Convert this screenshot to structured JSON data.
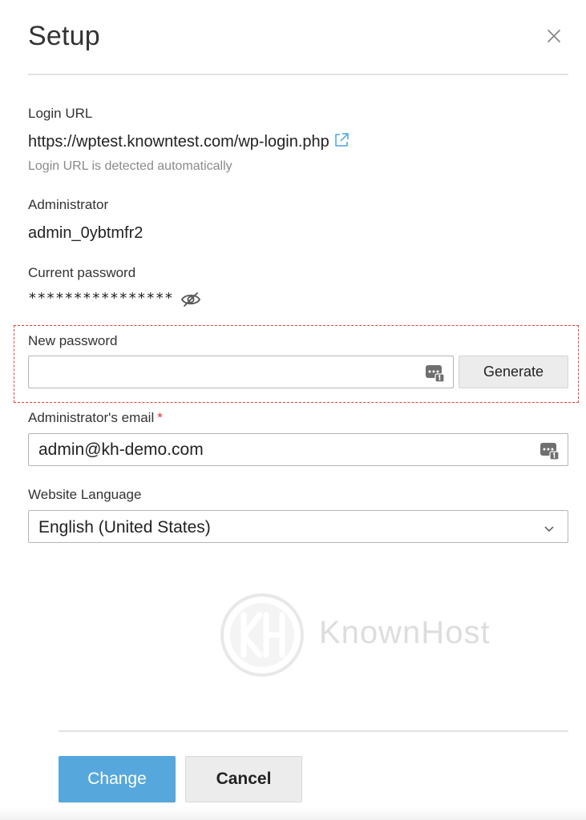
{
  "dialog": {
    "title": "Setup",
    "close_icon": "close-icon"
  },
  "login_url": {
    "label": "Login URL",
    "value": "https://wptest.knowntest.com/wp-login.php",
    "link_icon": "external-link-icon",
    "hint": "Login URL is detected automatically"
  },
  "administrator": {
    "label": "Administrator",
    "value": "admin_0ybtmfr2"
  },
  "current_password": {
    "label": "Current password",
    "masked_value": "****************",
    "toggle_icon": "eye-slash-icon"
  },
  "new_password": {
    "label": "New password",
    "value": "",
    "placeholder": "",
    "field_icon": "password-manager-icon",
    "generate_label": "Generate"
  },
  "admin_email": {
    "label": "Administrator's email",
    "required_mark": "*",
    "value": "admin@kh-demo.com",
    "field_icon": "password-manager-icon"
  },
  "language": {
    "label": "Website Language",
    "selected": "English (United States)",
    "chevron_icon": "chevron-down-icon"
  },
  "watermark": {
    "text": "KnownHost"
  },
  "footer": {
    "change_label": "Change",
    "cancel_label": "Cancel"
  },
  "colors": {
    "primary": "#56a8dc",
    "highlight": "#e0413a",
    "required": "#d63232"
  }
}
